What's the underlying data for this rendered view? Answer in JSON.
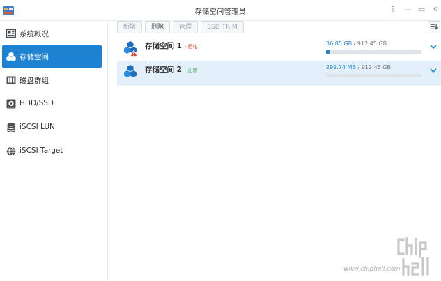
{
  "window": {
    "title": "存储空间管理员",
    "buttons": [
      "?",
      "—",
      "▭",
      "✕"
    ]
  },
  "sidebar": {
    "items": [
      {
        "label": "系统概况",
        "icon": "overview-icon",
        "active": false
      },
      {
        "label": "存储空间",
        "icon": "volume-icon",
        "active": true
      },
      {
        "label": "磁盘群组",
        "icon": "disk-group-icon",
        "active": false
      },
      {
        "label": "HDD/SSD",
        "icon": "hdd-icon",
        "active": false
      },
      {
        "label": "iSCSI LUN",
        "icon": "iscsi-lun-icon",
        "active": false
      },
      {
        "label": "iSCSI Target",
        "icon": "iscsi-target-icon",
        "active": false
      }
    ]
  },
  "toolbar": {
    "create_label": "新增",
    "delete_label": "删除",
    "manage_label": "管理",
    "trim_label": "SSD TRIM"
  },
  "volumes": [
    {
      "name": "存储空间 1",
      "status": "退化",
      "status_type": "warning",
      "used": "36.85 GB",
      "total": "912.45 GB",
      "usage_fraction": 0.04
    },
    {
      "name": "存储空间 2",
      "status": "正常",
      "status_type": "normal",
      "used": "299.74 MB",
      "total": "912.46 GB",
      "usage_fraction": 0.0003
    }
  ],
  "watermark": {
    "url": "www.chiphell.com",
    "logo": "chiphell-logo"
  },
  "colors": {
    "accent": "#1d82d2",
    "warning": "#e03c31",
    "normal": "#3ea84d",
    "selected_row": "#e3f0fb"
  }
}
